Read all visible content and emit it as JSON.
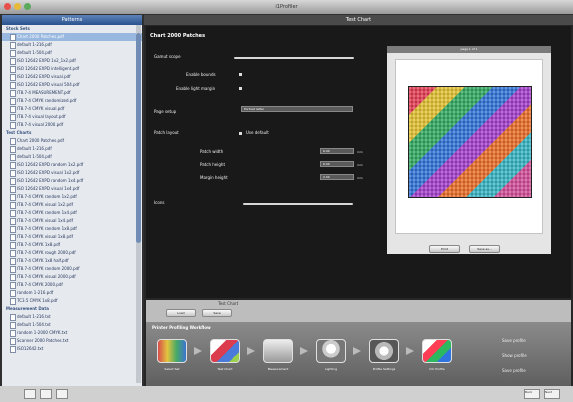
{
  "app": {
    "title": "i1Profiler",
    "main_title": "Test Chart",
    "sidebar_title": "Patterns"
  },
  "sidebar": {
    "groups": [
      {
        "label": "Stock Sets",
        "items": [
          "Chart 2000 Patches.pdf",
          "default 1-216.pdf",
          "default 1-504.pdf",
          "ISO 12642 EXPD 1x2_1x2.pdf",
          "ISO 12642 EXPD intelligent.pdf",
          "ISO 12642 EXPD visual.pdf",
          "ISO 12642 EXPD visual 504.pdf",
          "IT8.7-4 MEASUREMENT.pdf",
          "IT8.7-4 CMYK randomized.pdf",
          "IT8.7-4 CMYK visual.pdf",
          "IT8.7-4 visual layout.pdf",
          "IT8.7-4 visual 2000.pdf"
        ]
      },
      {
        "label": "Test Charts",
        "items": [
          "Chart 2000 Patches.pdf",
          "default 1-216.pdf",
          "default 1-504.pdf",
          "ISO 12642 EXPD random 1x2.pdf",
          "ISO 12642 EXPD visual 1x2.pdf",
          "ISO 12642 EXPD random 1x4.pdf",
          "ISO 12642 EXPD visual 1x4.pdf",
          "IT8.7-4 CMYK random 1x2.pdf",
          "IT8.7-4 CMYK visual 1x2.pdf",
          "IT8.7-4 CMYK random 1x4.pdf",
          "IT8.7-4 CMYK visual 1x4.pdf",
          "IT8.7-4 CMYK random 1x8.pdf",
          "IT8.7-4 CMYK visual 1x8.pdf",
          "IT8.7-4 CMYK 1x8.pdf",
          "IT8.7-4 CMYK rough 2000.pdf",
          "IT8.7-4 CMYK 1x8 half.pdf",
          "IT8.7-4 CMYK random 2000.pdf",
          "IT8.7-4 CMYK visual 2000.pdf",
          "IT8.7-4 CMYK 2000.pdf",
          "random 1-216.pdf",
          "TC3.5 CMYK 1x8.pdf"
        ]
      },
      {
        "label": "Measurement Data",
        "items": [
          "default 1-216.txt",
          "default 1-504.txt",
          "random 1-2000 CMYK.txt",
          "Scanner 2000 Patches.txt",
          "ISO12642.txt"
        ]
      }
    ]
  },
  "panel": {
    "title": "Chart 2000 Patches",
    "sections": [
      "Gamut scope",
      "Page setup",
      "Patch layout",
      "Icons"
    ],
    "labels": [
      "Enable bounds",
      "Enable light margin",
      "Patch width",
      "Patch height",
      "Margin height"
    ],
    "values": [
      "Default",
      "Portrait letter",
      "6.00",
      "6.00",
      "2.00"
    ],
    "checkbox_label": "Use default",
    "units": [
      "mm",
      "mm",
      "mm"
    ]
  },
  "preview": {
    "title": "page 1 of 1",
    "buttons": [
      "Print",
      "Save as..."
    ]
  },
  "controls": {
    "title": "Test Chart",
    "buttons": [
      "Load",
      "Save"
    ]
  },
  "workflow": {
    "title": "Printer Profiling Workflow",
    "steps": [
      "Select Set",
      "Test Chart",
      "Measurement",
      "Lighting",
      "Profile Settings",
      "ICC Profile"
    ],
    "side_text": [
      "Save profile",
      "Show profile",
      "Save profile"
    ]
  },
  "statusbar": {
    "buttons": [
      "<",
      "?",
      ">"
    ],
    "right": [
      "Back",
      "Next"
    ]
  },
  "colors": {
    "sidebar_header": "#29538f",
    "selection": "#99b8df",
    "accent": "#5e83b9"
  }
}
